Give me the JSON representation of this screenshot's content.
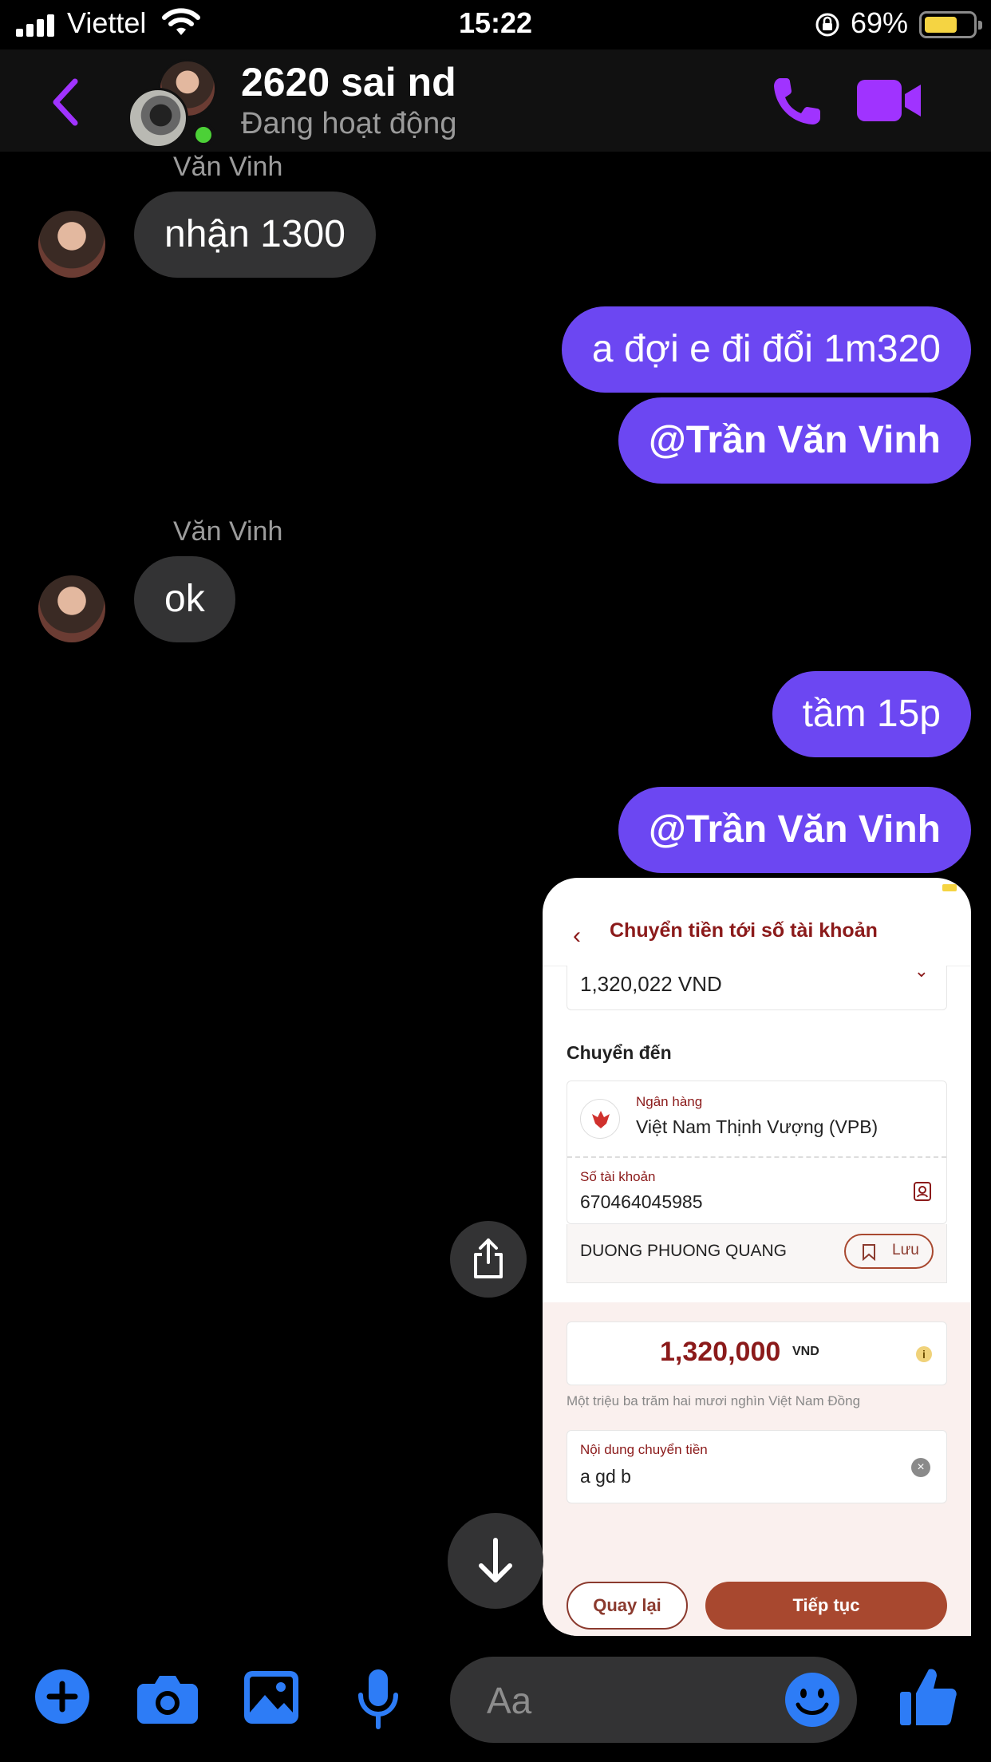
{
  "status_bar": {
    "carrier": "Viettel",
    "time": "15:22",
    "battery_percent": "69%",
    "battery_level": 0.69
  },
  "header": {
    "title": "2620 sai nd",
    "status": "Đang hoạt động",
    "icons": [
      "back-chevron-icon",
      "phone-icon",
      "video-camera-icon"
    ]
  },
  "messages": [
    {
      "from": "Văn Vinh",
      "text": "nhận 1300"
    },
    {
      "from": "me",
      "text": "a đợi e đi đổi 1m320"
    },
    {
      "from": "me",
      "text": "@Trần Văn Vinh"
    },
    {
      "from": "Văn Vinh",
      "text": "ok"
    },
    {
      "from": "me",
      "text": "tầm 15p"
    },
    {
      "from": "me",
      "text": "@Trần Văn Vinh"
    }
  ],
  "shared_screenshot": {
    "title": "Chuyển tiền tới số tài khoản",
    "source_amount": "1,320,022 VND",
    "section_label": "Chuyển đến",
    "bank_label": "Ngân hàng",
    "bank_value": "Việt Nam Thịnh Vượng (VPB)",
    "account_label": "Số tài khoản",
    "account_value": "670464045985",
    "recipient_name": "DUONG PHUONG QUANG",
    "save_label": "Lưu",
    "amount": "1,320,000",
    "currency": "VND",
    "amount_words": "Một triệu ba trăm hai mươi nghìn Việt Nam Đồng",
    "note_label": "Nội dung chuyển tiền",
    "note_value": "a gd b",
    "back_button": "Quay lại",
    "next_button": "Tiếp tục"
  },
  "composer": {
    "placeholder": "Aa",
    "icons": [
      "plus-icon",
      "camera-icon",
      "image-icon",
      "microphone-icon",
      "emoji-icon",
      "thumbs-up-icon"
    ]
  },
  "colors": {
    "accent": "#6c47f2",
    "messenger_purple": "#a033ff",
    "toolbar_blue": "#2d7cf6",
    "bank_red": "#8b1a1a",
    "incoming_bubble": "#333334"
  }
}
